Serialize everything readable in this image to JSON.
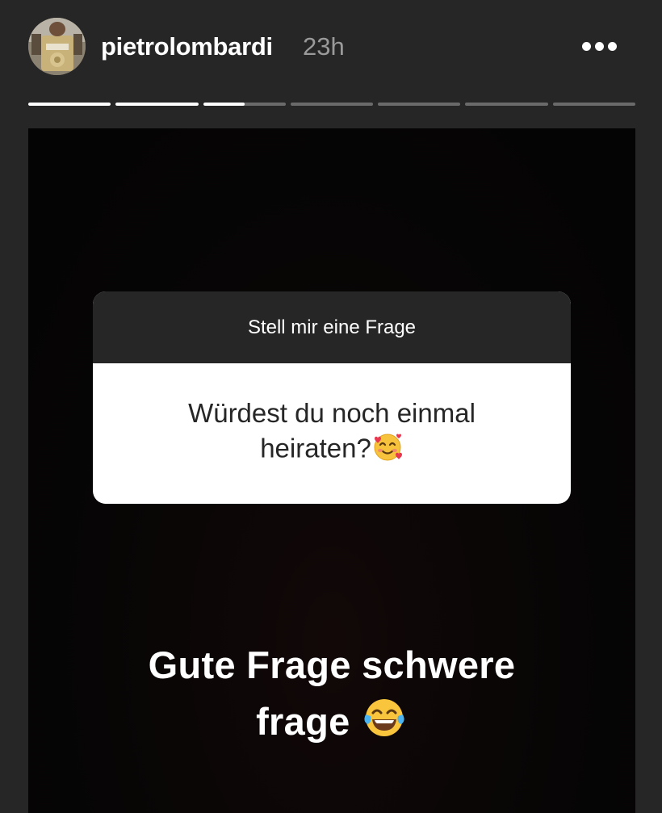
{
  "header": {
    "username": "pietrolombardi",
    "time": "23h",
    "more_icon": "more-horizontal-icon"
  },
  "progress": {
    "segments": [
      1,
      1,
      0.5,
      0,
      0,
      0,
      0
    ],
    "active_index": 2
  },
  "story": {
    "question_box": {
      "title": "Stell mir eine Frage",
      "question_line1": "Würdest du noch einmal",
      "question_line2": "heiraten?",
      "question_emoji": "smiling-face-with-hearts-icon"
    },
    "caption_line1": "Gute Frage schwere",
    "caption_line2": "frage",
    "caption_emoji": "face-with-tears-of-joy-icon"
  },
  "colors": {
    "background": "#262626",
    "story_bg": "#060505",
    "progress_done": "#ffffff",
    "progress_pending": "#6a6a6a",
    "time": "#9a9a9a"
  }
}
